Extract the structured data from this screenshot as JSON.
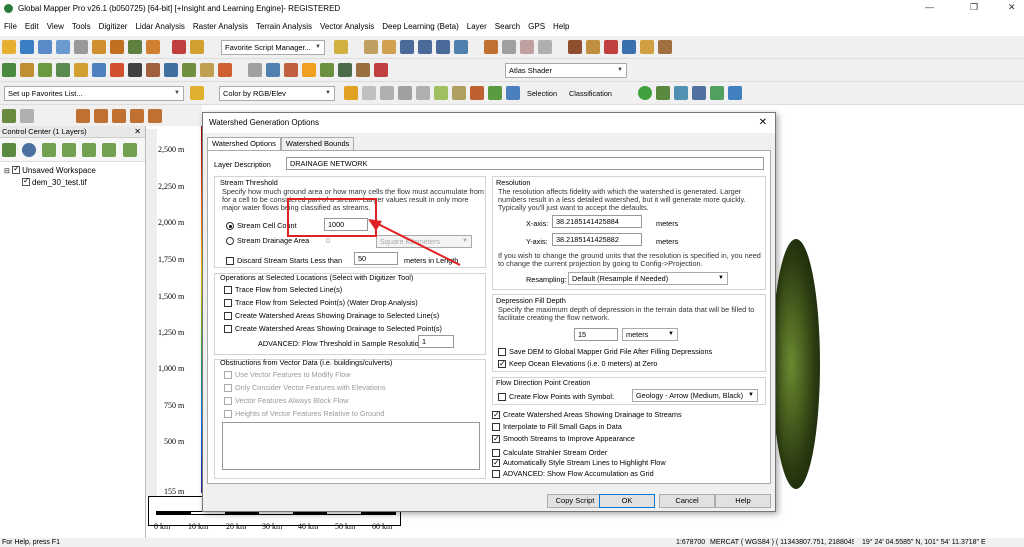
{
  "app": {
    "title": "Global Mapper Pro v26.1 (b050725) [64-bit] [+Insight and Learning Engine]- REGISTERED"
  },
  "menu": [
    "File",
    "Edit",
    "View",
    "Tools",
    "Digitizer",
    "Lidar Analysis",
    "Raster Analysis",
    "Terrain Analysis",
    "Vector Analysis",
    "Deep Learning (Beta)",
    "Layer",
    "Search",
    "GPS",
    "Help"
  ],
  "toolbar": {
    "script_combo": "Favorite Script Manager...",
    "shader_combo": "Atlas Shader",
    "favorites_combo": "Set up Favorites List...",
    "color_combo": "Color by RGB/Elev",
    "selection_label": "Selection",
    "classification_label": "Classification"
  },
  "control_center": {
    "title": "Control Center (1 Layers)",
    "workspace": "Unsaved Workspace",
    "layer": "dem_30_test.tif"
  },
  "map": {
    "y_labels": [
      "2,500 m",
      "2,250 m",
      "2,000 m",
      "1,750 m",
      "1,500 m",
      "1,250 m",
      "1,000 m",
      "750 m",
      "500 m",
      "155 m"
    ],
    "x_labels": [
      "0 km",
      "10 km",
      "20 km",
      "30 km",
      "40 km",
      "50 km",
      "60 km"
    ]
  },
  "status": {
    "help": "For Help, press F1",
    "scale": "1:678700",
    "projection": "MERCAT ( WGS84 ) ( 11343807.751, 2188049.064 m )",
    "coords": "19° 24' 04.5585\" N, 101° 54' 11.3718\" E"
  },
  "dialog": {
    "title": "Watershed Generation Options",
    "tabs": [
      "Watershed Options",
      "Watershed Bounds"
    ],
    "layer_description_label": "Layer Description",
    "layer_description": "DRAINAGE NETWORK",
    "stream_threshold": {
      "title": "Stream Threshold",
      "desc": "Specify how much ground area or how many cells the flow must accumulate from for a cell to be considered part of a stream. Larger values result in only more major water flows being classified as streams.",
      "cell_count_label": "Stream Cell Count",
      "cell_count": "1000",
      "drainage_area_label": "Stream Drainage Area",
      "drainage_area": "0",
      "area_unit": "Square Kilometers",
      "discard_label": "Discard Stream Starts Less than",
      "discard_value": "50",
      "discard_unit": "meters in Length"
    },
    "ops": {
      "title": "Operations at Selected Locations (Select with Digitizer Tool)",
      "items": [
        "Trace Flow from Selected Line(s)",
        "Trace Flow from Selected Point(s) (Water Drop Analysis)",
        "Create Watershed Areas Showing Drainage to Selected Line(s)",
        "Create Watershed Areas Showing Drainage to Selected Point(s)"
      ],
      "advanced_label": "ADVANCED: Flow Threshold in Sample Resolution:",
      "advanced_value": "1"
    },
    "obstructions": {
      "title": "Obstructions from Vector Data (i.e. buildings/culverts)",
      "items": [
        "Use Vector Features to Modify Flow",
        "Only Consider Vector Features with Elevations",
        "Vector Features Always Block Flow",
        "Heights of Vector Features Relative to Ground"
      ]
    },
    "resolution": {
      "title": "Resolution",
      "desc": "The resolution affects fidelity with which the watershed is generated. Larger numbers result in a less detailed watershed, but it will generate more quickly. Typically you'll just want to accept the defaults.",
      "x_label": "X-axis:",
      "x_value": "38.2185141425884",
      "y_label": "Y-axis:",
      "y_value": "38.2185141425882",
      "unit": "meters",
      "note": "If you wish to change the ground units that the resolution is specified in, you need to change the current projection by going to Config->Projection.",
      "resampling_label": "Resampling:",
      "resampling": "Default (Resample if Needed)"
    },
    "depression": {
      "title": "Depression Fill Depth",
      "desc": "Specify the maximum depth of depression in the terrain data that will be filled to facilitate creating the flow network.",
      "value": "15",
      "unit": "meters",
      "save_label": "Save DEM to Global Mapper Grid File After Filling Depressions",
      "keep_label": "Keep Ocean Elevations (i.e. 0 meters) at Zero"
    },
    "flow": {
      "title": "Flow Direction Point Creation",
      "create_label": "Create Flow Points with Symbol:",
      "symbol": "Geology - Arrow (Medium, Black)"
    },
    "options": [
      {
        "label": "Create Watershed Areas Showing Drainage to Streams",
        "checked": true
      },
      {
        "label": "Interpolate to Fill Small Gaps in Data",
        "checked": false
      },
      {
        "label": "Smooth Streams to Improve Appearance",
        "checked": true
      },
      {
        "label": "Calculate Strahler Stream Order",
        "checked": false
      },
      {
        "label": "Automatically Style Stream Lines to Highlight Flow",
        "checked": true
      },
      {
        "label": "ADVANCED: Show Flow Accumulation as Grid",
        "checked": false
      }
    ],
    "buttons": {
      "copy_script": "Copy Script",
      "ok": "OK",
      "cancel": "Cancel",
      "help": "Help"
    }
  }
}
